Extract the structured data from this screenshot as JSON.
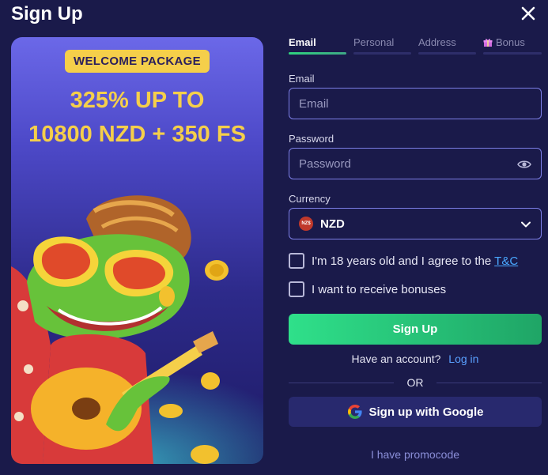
{
  "modal": {
    "title": "Sign Up"
  },
  "promo": {
    "badge": "WELCOME PACKAGE",
    "line1": "325% UP TO",
    "line2": "10800 NZD + 350 FS"
  },
  "tabs": [
    {
      "label": "Email",
      "active": true
    },
    {
      "label": "Personal",
      "active": false
    },
    {
      "label": "Address",
      "active": false
    },
    {
      "label": "Bonus",
      "active": false,
      "icon": "gift-icon"
    }
  ],
  "form": {
    "email": {
      "label": "Email",
      "placeholder": "Email",
      "value": ""
    },
    "password": {
      "label": "Password",
      "placeholder": "Password",
      "value": ""
    },
    "currency": {
      "label": "Currency",
      "flag_text": "NZ$",
      "value": "NZD"
    },
    "age_check": {
      "text": "I'm 18 years old and I agree to the",
      "link": "T&C",
      "checked": false
    },
    "bonus_check": {
      "text": "I want to receive bonuses",
      "checked": false
    },
    "submit_label": "Sign Up",
    "have_account": "Have an account?",
    "login_link": "Log in",
    "or_text": "OR",
    "google_label": "Sign up with Google",
    "promocode_link": "I have promocode"
  },
  "colors": {
    "background": "#1a1a4a",
    "accent_green": "#2fe08a",
    "promo_yellow": "#f5cf4a",
    "field_border": "#7c7ee6",
    "link_blue": "#5aa0ff"
  }
}
